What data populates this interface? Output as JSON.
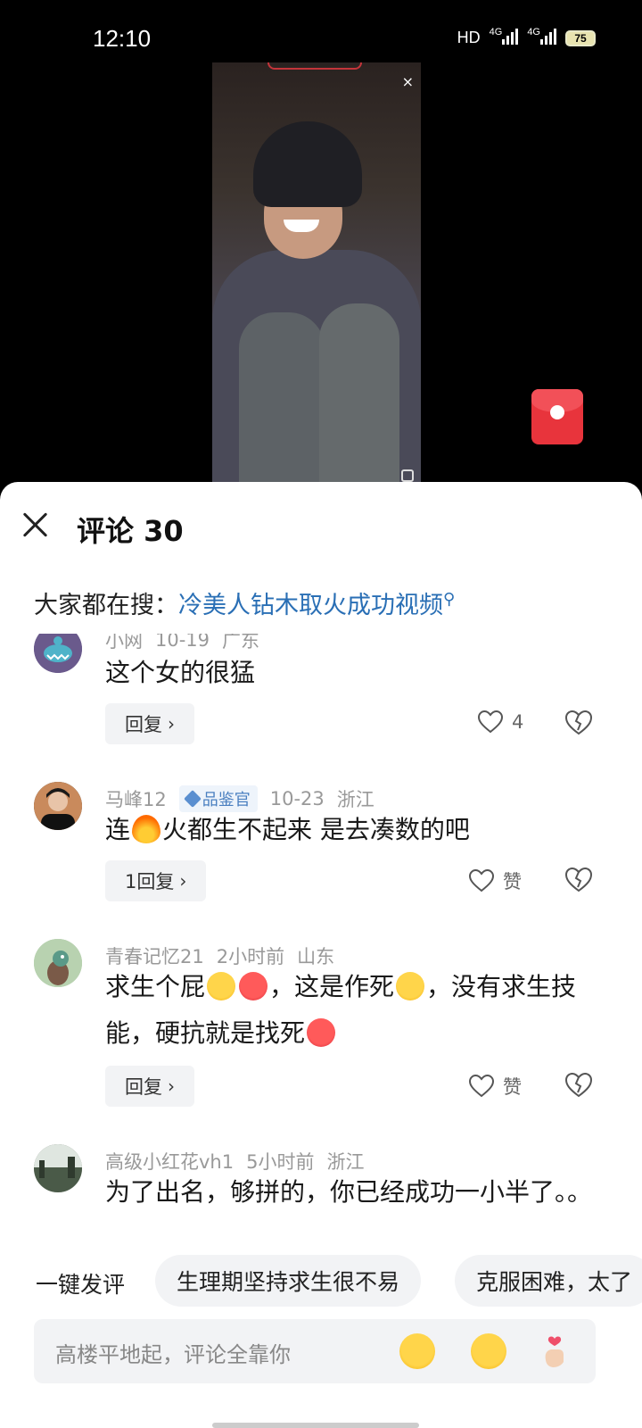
{
  "status_bar": {
    "time": "12:10",
    "network": "HD",
    "sim1": "4G",
    "sim2": "4G",
    "battery": "75"
  },
  "sheet": {
    "title": "评论 30",
    "search_prefix": "大家都在搜：",
    "search_link": "冷美人钻木取火成功视频"
  },
  "comments": [
    {
      "user": "小网",
      "date": "10-19",
      "location": "广东",
      "text": "这个女的很猛",
      "reply_label": "回复",
      "like_label": "4",
      "avatar_color": "#6a5a8c"
    },
    {
      "user": "马峰12",
      "badge": "品鉴官",
      "date": "10-23",
      "location": "浙江",
      "text_before": "连",
      "text_after": "火都生不起来 是去凑数的吧",
      "reply_label": "1回复",
      "like_label": "赞",
      "avatar_color": "#2b2b2b"
    },
    {
      "user": "青春记忆21",
      "date": "2小时前",
      "location": "山东",
      "text_a": "求生个屁",
      "text_b": "，这是作死",
      "text_c": "，没有求生技能，硬抗就是找死",
      "reply_label": "回复",
      "like_label": "赞",
      "avatar_color": "#a8c7a0"
    },
    {
      "user": "高级小红花vh1",
      "date": "5小时前",
      "location": "浙江",
      "text": "为了出名，够拼的，你已经成功一小半了。。",
      "avatar_color": "#5d6a5a"
    }
  ],
  "quick_comment": {
    "label": "一键发评",
    "chips": [
      "生理期坚持求生很不易",
      "克服困难，太了"
    ]
  },
  "input": {
    "placeholder": "高楼平地起，评论全靠你"
  }
}
